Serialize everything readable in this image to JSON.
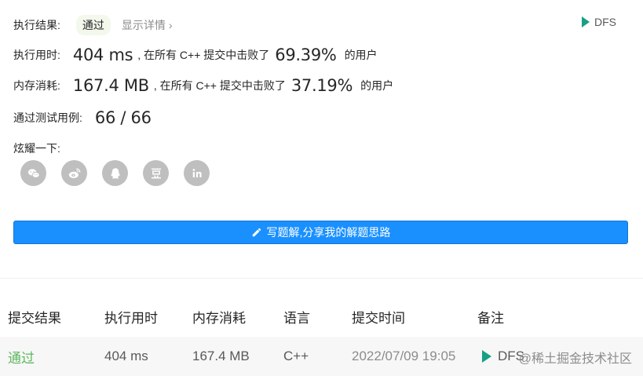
{
  "result": {
    "label": "执行结果:",
    "status": "通过",
    "detail_link": "显示详情",
    "tag": "DFS"
  },
  "runtime": {
    "label": "执行用时:",
    "value": "404 ms",
    "beat_prefix": ", 在所有 C++ 提交中击败了",
    "percent": "69.39%",
    "suffix": "的用户"
  },
  "memory": {
    "label": "内存消耗:",
    "value": "167.4 MB",
    "beat_prefix": ", 在所有 C++ 提交中击败了",
    "percent": "37.19%",
    "suffix": "的用户"
  },
  "testcases": {
    "label": "通过测试用例:",
    "value": "66 / 66"
  },
  "share": {
    "label": "炫耀一下:",
    "icons": [
      "wechat-icon",
      "weibo-icon",
      "qq-icon",
      "douban-icon",
      "linkedin-icon"
    ]
  },
  "write_button": {
    "label": "写题解,分享我的解题思路"
  },
  "table": {
    "headers": [
      "提交结果",
      "执行用时",
      "内存消耗",
      "语言",
      "提交时间",
      "备注"
    ],
    "rows": [
      {
        "result": "通过",
        "runtime": "404 ms",
        "memory": "167.4 MB",
        "language": "C++",
        "time": "2022/07/09 19:05",
        "note": "DFS"
      }
    ]
  },
  "watermark": "@稀土掘金技术社区",
  "colors": {
    "accent_blue": "#1a90ff",
    "pass_green": "#5cb85c",
    "tag_teal": "#16a085",
    "icon_gray": "#bfbfbf"
  }
}
